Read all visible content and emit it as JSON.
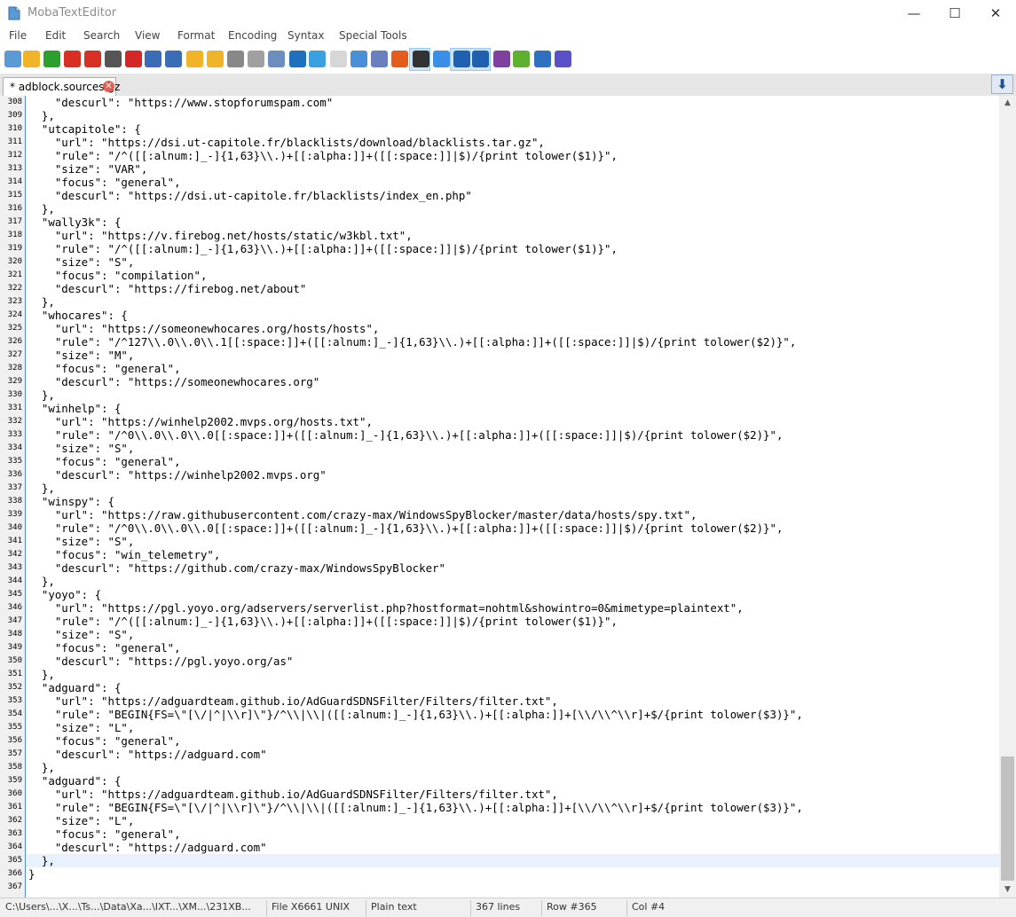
{
  "window": {
    "title": "MobaTextEditor",
    "minimize_glyph": "—",
    "maximize_glyph": "☐",
    "close_glyph": "✕"
  },
  "menu": {
    "items": [
      "File",
      "Edit",
      "Search",
      "View",
      "Format",
      "Encoding",
      "Syntax",
      "Special Tools"
    ]
  },
  "toolbar": {
    "icons": [
      "new-file-icon",
      "open-folder-icon",
      "reload-icon",
      "save-icon",
      "save-all-icon",
      "print-icon",
      "close-file-icon",
      "outdent-icon",
      "indent-icon",
      "bookmark-add-icon",
      "bookmark-next-icon",
      "cut-icon",
      "copy-icon",
      "paste-icon",
      "search-icon",
      "replace-icon",
      "disabled-icon",
      "compare-icon",
      "split-view-icon",
      "windows-eol-icon",
      "linux-eol-icon",
      "mac-eol-icon",
      "word-wrap-icon",
      "line-marker-icon",
      "paragraph-icon",
      "highlighter-icon",
      "settings-icon",
      "close-window-icon"
    ],
    "colors": [
      "#5b9bd5",
      "#f0b429",
      "#2ca02c",
      "#d93025",
      "#d93025",
      "#555555",
      "#d62728",
      "#3a6db5",
      "#3a6db5",
      "#f0b429",
      "#f0b429",
      "#888888",
      "#a0a0a0",
      "#6c8ebf",
      "#1f6fbf",
      "#3aa0e0",
      "#b0b0b0",
      "#4a90d9",
      "#6a7fbf",
      "#e45d1c",
      "#333333",
      "#3a8ee6",
      "#2060b0",
      "#2060b0",
      "#8040a0",
      "#60b030",
      "#3070c0",
      "#5a50c8"
    ]
  },
  "tabs": [
    {
      "label": "* adblock.sources.gz",
      "close_glyph": "✕"
    }
  ],
  "tabbar": {
    "scroll_down_glyph": "⬇"
  },
  "editor": {
    "lines": [
      {
        "num": "308",
        "text": "    \"descurl\": \"https://www.stopforumspam.com\""
      },
      {
        "num": "309",
        "text": "  },"
      },
      {
        "num": "310",
        "text": "  \"utcapitole\": {"
      },
      {
        "num": "311",
        "text": "    \"url\": \"https://dsi.ut-capitole.fr/blacklists/download/blacklists.tar.gz\","
      },
      {
        "num": "312",
        "text": "    \"rule\": \"/^([[:alnum:]_-]{1,63}\\\\.)+[[:alpha:]]+([[:space:]]|$)/{print tolower($1)}\","
      },
      {
        "num": "313",
        "text": "    \"size\": \"VAR\","
      },
      {
        "num": "314",
        "text": "    \"focus\": \"general\","
      },
      {
        "num": "315",
        "text": "    \"descurl\": \"https://dsi.ut-capitole.fr/blacklists/index_en.php\""
      },
      {
        "num": "316",
        "text": "  },"
      },
      {
        "num": "317",
        "text": "  \"wally3k\": {"
      },
      {
        "num": "318",
        "text": "    \"url\": \"https://v.firebog.net/hosts/static/w3kbl.txt\","
      },
      {
        "num": "319",
        "text": "    \"rule\": \"/^([[:alnum:]_-]{1,63}\\\\.)+[[:alpha:]]+([[:space:]]|$)/{print tolower($1)}\","
      },
      {
        "num": "320",
        "text": "    \"size\": \"S\","
      },
      {
        "num": "321",
        "text": "    \"focus\": \"compilation\","
      },
      {
        "num": "322",
        "text": "    \"descurl\": \"https://firebog.net/about\""
      },
      {
        "num": "323",
        "text": "  },"
      },
      {
        "num": "324",
        "text": "  \"whocares\": {"
      },
      {
        "num": "325",
        "text": "    \"url\": \"https://someonewhocares.org/hosts/hosts\","
      },
      {
        "num": "326",
        "text": "    \"rule\": \"/^127\\\\.0\\\\.0\\\\.1[[:space:]]+([[:alnum:]_-]{1,63}\\\\.)+[[:alpha:]]+([[:space:]]|$)/{print tolower($2)}\","
      },
      {
        "num": "327",
        "text": "    \"size\": \"M\","
      },
      {
        "num": "328",
        "text": "    \"focus\": \"general\","
      },
      {
        "num": "329",
        "text": "    \"descurl\": \"https://someonewhocares.org\""
      },
      {
        "num": "330",
        "text": "  },"
      },
      {
        "num": "331",
        "text": "  \"winhelp\": {"
      },
      {
        "num": "332",
        "text": "    \"url\": \"https://winhelp2002.mvps.org/hosts.txt\","
      },
      {
        "num": "333",
        "text": "    \"rule\": \"/^0\\\\.0\\\\.0\\\\.0[[:space:]]+([[:alnum:]_-]{1,63}\\\\.)+[[:alpha:]]+([[:space:]]|$)/{print tolower($2)}\","
      },
      {
        "num": "334",
        "text": "    \"size\": \"S\","
      },
      {
        "num": "335",
        "text": "    \"focus\": \"general\","
      },
      {
        "num": "336",
        "text": "    \"descurl\": \"https://winhelp2002.mvps.org\""
      },
      {
        "num": "337",
        "text": "  },"
      },
      {
        "num": "338",
        "text": "  \"winspy\": {"
      },
      {
        "num": "339",
        "text": "    \"url\": \"https://raw.githubusercontent.com/crazy-max/WindowsSpyBlocker/master/data/hosts/spy.txt\","
      },
      {
        "num": "340",
        "text": "    \"rule\": \"/^0\\\\.0\\\\.0\\\\.0[[:space:]]+([[:alnum:]_-]{1,63}\\\\.)+[[:alpha:]]+([[:space:]]|$)/{print tolower($2)}\","
      },
      {
        "num": "341",
        "text": "    \"size\": \"S\","
      },
      {
        "num": "342",
        "text": "    \"focus\": \"win_telemetry\","
      },
      {
        "num": "343",
        "text": "    \"descurl\": \"https://github.com/crazy-max/WindowsSpyBlocker\""
      },
      {
        "num": "344",
        "text": "  },"
      },
      {
        "num": "345",
        "text": "  \"yoyo\": {"
      },
      {
        "num": "346",
        "text": "    \"url\": \"https://pgl.yoyo.org/adservers/serverlist.php?hostformat=nohtml&showintro=0&mimetype=plaintext\","
      },
      {
        "num": "347",
        "text": "    \"rule\": \"/^([[:alnum:]_-]{1,63}\\\\.)+[[:alpha:]]+([[:space:]]|$)/{print tolower($1)}\","
      },
      {
        "num": "348",
        "text": "    \"size\": \"S\","
      },
      {
        "num": "349",
        "text": "    \"focus\": \"general\","
      },
      {
        "num": "350",
        "text": "    \"descurl\": \"https://pgl.yoyo.org/as\""
      },
      {
        "num": "351",
        "text": "  },"
      },
      {
        "num": "352",
        "text": "  \"adguard\": {"
      },
      {
        "num": "353",
        "text": "    \"url\": \"https://adguardteam.github.io/AdGuardSDNSFilter/Filters/filter.txt\","
      },
      {
        "num": "354",
        "text": "    \"rule\": \"BEGIN{FS=\\\"[\\/|^|\\\\r]\\\"}/^\\\\|\\\\|([[:alnum:]_-]{1,63}\\\\.)+[[:alpha:]]+[\\\\/\\\\^\\\\r]+$/{print tolower($3)}\","
      },
      {
        "num": "355",
        "text": "    \"size\": \"L\","
      },
      {
        "num": "356",
        "text": "    \"focus\": \"general\","
      },
      {
        "num": "357",
        "text": "    \"descurl\": \"https://adguard.com\""
      },
      {
        "num": "358",
        "text": "  },"
      },
      {
        "num": "359",
        "text": "  \"adguard\": {"
      },
      {
        "num": "360",
        "text": "    \"url\": \"https://adguardteam.github.io/AdGuardSDNSFilter/Filters/filter.txt\","
      },
      {
        "num": "361",
        "text": "    \"rule\": \"BEGIN{FS=\\\"[\\/|^|\\\\r]\\\"}/^\\\\|\\\\|([[:alnum:]_-]{1,63}\\\\.)+[[:alpha:]]+[\\\\/\\\\^\\\\r]+$/{print tolower($3)}\","
      },
      {
        "num": "362",
        "text": "    \"size\": \"L\","
      },
      {
        "num": "363",
        "text": "    \"focus\": \"general\","
      },
      {
        "num": "364",
        "text": "    \"descurl\": \"https://adguard.com\""
      },
      {
        "num": "365",
        "text": "  },"
      },
      {
        "num": "366",
        "text": "}"
      },
      {
        "num": "367",
        "text": ""
      }
    ],
    "current_line": "365"
  },
  "scrollbar": {
    "up_glyph": "▲",
    "down_glyph": "▼",
    "scroll_position": 0.95
  },
  "statusbar": {
    "segments": [
      "C:\\Users\\...\\X...\\Ts...\\Data\\Xa...\\IXT...\\XM...\\231XB...",
      "File X6661 UNIX",
      "Plain text",
      "367 lines",
      "Row #365",
      "Col #4"
    ]
  }
}
